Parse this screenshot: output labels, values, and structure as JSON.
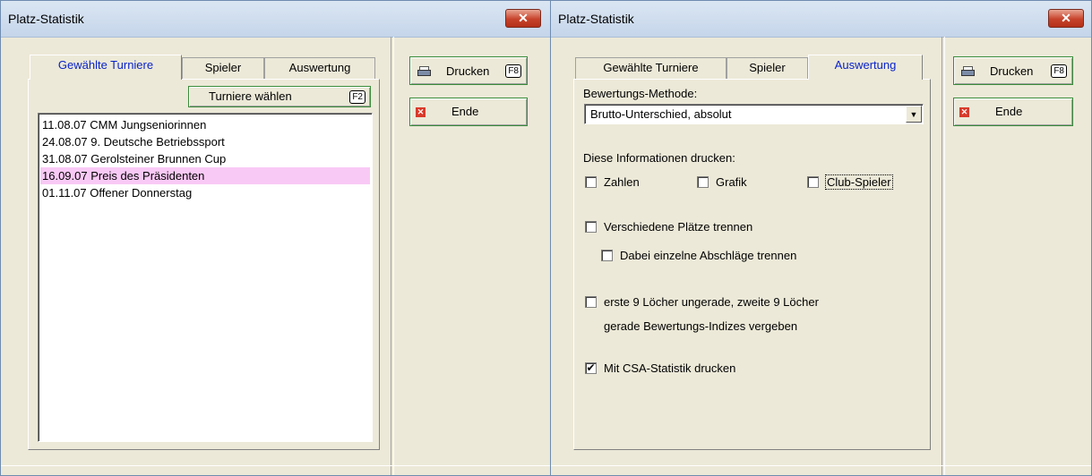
{
  "window1": {
    "title": "Platz-Statistik",
    "close": "✕",
    "tabs": [
      "Gewählte Turniere",
      "Spieler",
      "Auswertung"
    ],
    "choose_button": {
      "label": "Turniere wählen",
      "key": "F2"
    },
    "tournaments": [
      "11.08.07 CMM Jungseniorinnen",
      "24.08.07 9. Deutsche Betriebssport",
      "31.08.07 Gerolsteiner Brunnen Cup",
      "16.09.07 Preis des Präsidenten",
      "01.11.07 Offener Donnerstag"
    ],
    "selected_index": 3,
    "print_button": {
      "label": "Drucken",
      "key": "F8"
    },
    "end_button": {
      "label": "Ende"
    }
  },
  "window2": {
    "title": "Platz-Statistik",
    "close": "✕",
    "tabs": [
      "Gewählte Turniere",
      "Spieler",
      "Auswertung"
    ],
    "method_label": "Bewertungs-Methode:",
    "method_value": "Brutto-Unterschied, absolut",
    "print_info_label": "Diese Informationen drucken:",
    "cb_zahlen": "Zahlen",
    "cb_grafik": "Grafik",
    "cb_club": "Club-Spieler",
    "cb_separate": "Verschiedene Plätze trennen",
    "cb_tees": "Dabei einzelne Abschläge trennen",
    "cb_holes_line1": "erste 9 Löcher ungerade, zweite 9 Löcher",
    "cb_holes_line2": "gerade Bewertungs-Indizes vergeben",
    "cb_csa": "Mit CSA-Statistik drucken",
    "check_mark": "✔",
    "print_button": {
      "label": "Drucken",
      "key": "F8"
    },
    "end_button": {
      "label": "Ende"
    }
  }
}
